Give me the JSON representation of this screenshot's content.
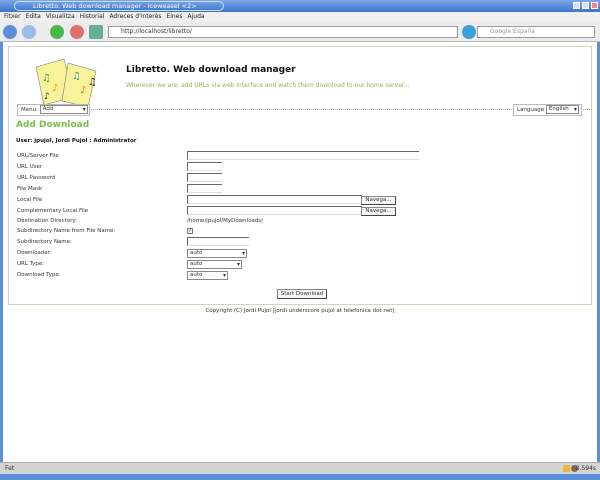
{
  "window": {
    "title": "Libretto. Web download manager - Iceweasel <2>"
  },
  "menu": [
    "Fitxer",
    "Edita",
    "Visualitza",
    "Historial",
    "Adreces d'interès",
    "Eines",
    "Ajuda"
  ],
  "toolbar": {
    "url": "http://localhost/libretto/",
    "search_placeholder": "Google España"
  },
  "header": {
    "title": "Libretto. Web download manager",
    "subtitle": "Wherever we are, add URLs via web interface and watch them download to our home server..."
  },
  "nav": {
    "menu_label": "Menu:",
    "menu_value": "Add",
    "language_label": "Language",
    "language_value": "English"
  },
  "page": {
    "heading": "Add Download",
    "user": "User: jpujol, Jordi Pujol : Administrator"
  },
  "form": {
    "url_server_file": "URL/Server File",
    "url_user": "URL User",
    "url_password": "URL Password",
    "file_mask": "File Mask",
    "local_file": "Local File",
    "complementary_local_file": "Complementary Local File",
    "browse": "Navega...",
    "destination_directory": "Destination Directory:",
    "destination_value": "/home/jpujol/MyDownloads/",
    "subdir_from_file": "Subdirectory Name from File Name:",
    "subdir_from_file_checked": true,
    "subdir_name": "Subdirectory Name:",
    "downloader": "Downloader:",
    "downloader_value": "auto",
    "url_type": "URL Type:",
    "url_type_value": "auto",
    "download_type": "Download Type:",
    "download_type_value": "auto",
    "submit": "Start Download"
  },
  "footer": {
    "copyright": "Copyright (C) Jordi Pujol [jordi underscore pujol at telefonica dot net]"
  },
  "status": {
    "text": "Fet",
    "timing": "0.594s"
  }
}
